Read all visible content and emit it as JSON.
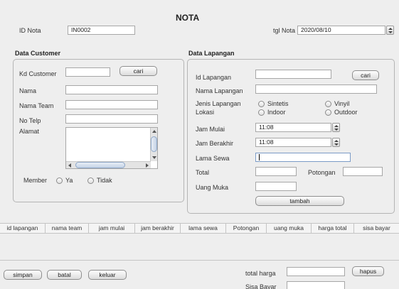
{
  "title": "NOTA",
  "id_nota": {
    "label": "ID Nota",
    "value": "IN0002"
  },
  "tgl_nota": {
    "label": "tgl Nota",
    "value": "2020/08/10"
  },
  "customer": {
    "header": "Data Customer",
    "kd_label": "Kd Customer",
    "kd_value": "",
    "cari_label": "cari",
    "nama_label": "Nama",
    "team_label": "Nama Team",
    "telp_label": "No Telp",
    "alamat_label": "Alamat",
    "member_label": "Member",
    "member_options": [
      "Ya",
      "Tidak"
    ]
  },
  "lapangan": {
    "header": "Data Lapangan",
    "id_label": "Id Lapangan",
    "cari_label": "cari",
    "nama_label": "Nama Lapangan",
    "jenis_label": "Jenis Lapangan",
    "jenis_options": [
      "Sintetis",
      "Vinyil"
    ],
    "lokasi_label": "Lokasi",
    "lokasi_options": [
      "Indoor",
      "Outdoor"
    ],
    "mulai_label": "Jam Mulai",
    "mulai_value": "11:08",
    "berakhir_label": "Jam Berakhir",
    "berakhir_value": "11:08",
    "lama_label": "Lama Sewa",
    "total_label": "Total",
    "potongan_label": "Potongan",
    "uang_muka_label": "Uang Muka",
    "tambah_label": "tambah"
  },
  "table": {
    "columns": [
      "id lapangan",
      "nama team",
      "jam mulai",
      "jam berakhir",
      "lama sewa",
      "Potongan",
      "uang muka",
      "harga total",
      "sisa bayar"
    ],
    "rows": []
  },
  "footer": {
    "simpan_label": "simpan",
    "batal_label": "batal",
    "keluar_label": "keluar",
    "total_harga_label": "total harga",
    "hapus_label": "hapus",
    "sisa_bayar_label": "Sisa Bayar"
  }
}
